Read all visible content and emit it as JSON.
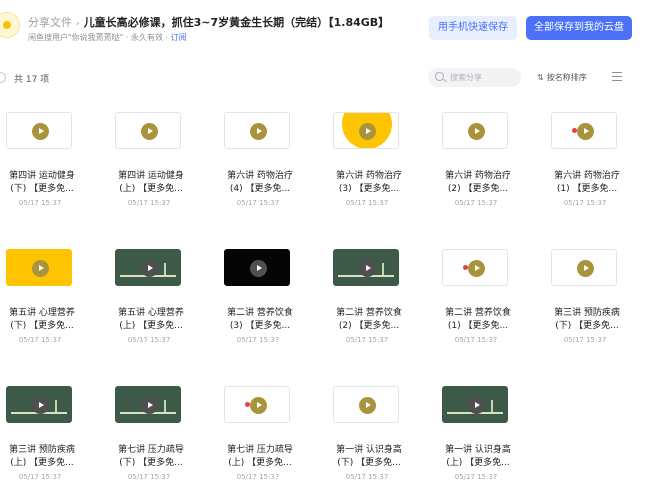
{
  "header": {
    "breadcrumb_root": "分享文件",
    "breadcrumb_sep": "›",
    "title": "儿童长高必修课，抓住3~7岁黄金生长期（完结）【1.84GB】",
    "sharer": "闲鱼搜用户\"你说我蔫蔫哒\" · 永久有效 · ",
    "subscribe": "订阅",
    "mobile_save_label": "用手机快速保存",
    "save_all_label": "全部保存到我的云盘"
  },
  "toolbar": {
    "count": "共 17 项",
    "search_placeholder": "搜索分享",
    "sort_icon": "⇅",
    "sort_label": "按名称排序"
  },
  "files": [
    {
      "line1": "第四讲 运动健身",
      "line2": "(下) 【更多免...",
      "date": "05/17 15:37",
      "thumb": "white"
    },
    {
      "line1": "第四讲 运动健身",
      "line2": "(上) 【更多免...",
      "date": "05/17 15:37",
      "thumb": "white"
    },
    {
      "line1": "第六讲 药物治疗",
      "line2": "(4) 【更多免...",
      "date": "05/17 15:37",
      "thumb": "white"
    },
    {
      "line1": "第六讲 药物治疗",
      "line2": "(3) 【更多免...",
      "date": "05/17 15:37",
      "thumb": "yellowcirc"
    },
    {
      "line1": "第六讲 药物治疗",
      "line2": "(2) 【更多免...",
      "date": "05/17 15:37",
      "thumb": "white"
    },
    {
      "line1": "第六讲 药物治疗",
      "line2": "(1) 【更多免...",
      "date": "05/17 15:37",
      "thumb": "dot"
    },
    {
      "line1": "第五讲 心理营养",
      "line2": "(下) 【更多免...",
      "date": "05/17 15:37",
      "thumb": "yellow"
    },
    {
      "line1": "第五讲 心理营养",
      "line2": "(上) 【更多免...",
      "date": "05/17 15:37",
      "thumb": "green"
    },
    {
      "line1": "第二讲 营养饮食",
      "line2": "(3) 【更多免...",
      "date": "05/17 15:37",
      "thumb": "black"
    },
    {
      "line1": "第二讲 营养饮食",
      "line2": "(2) 【更多免...",
      "date": "05/17 15:37",
      "thumb": "green"
    },
    {
      "line1": "第二讲 营养饮食",
      "line2": "(1) 【更多免...",
      "date": "05/17 15:37",
      "thumb": "dot"
    },
    {
      "line1": "第三讲 预防疾病",
      "line2": "(下) 【更多免...",
      "date": "05/17 15:37",
      "thumb": "white"
    },
    {
      "line1": "第三讲 预防疾病",
      "line2": "(上) 【更多免...",
      "date": "05/17 15:37",
      "thumb": "green"
    },
    {
      "line1": "第七讲 压力疏导",
      "line2": "(下) 【更多免...",
      "date": "05/17 15:37",
      "thumb": "green"
    },
    {
      "line1": "第七讲 压力疏导",
      "line2": "(上) 【更多免...",
      "date": "05/17 15:37",
      "thumb": "dot"
    },
    {
      "line1": "第一讲 认识身高",
      "line2": "(下) 【更多免...",
      "date": "05/17 15:37",
      "thumb": "white"
    },
    {
      "line1": "第一讲 认识身高",
      "line2": "(上) 【更多免...",
      "date": "05/17 15:37",
      "thumb": "green"
    }
  ],
  "colors": {
    "accent": "#4b72f6",
    "accent_light": "#e7efff"
  }
}
